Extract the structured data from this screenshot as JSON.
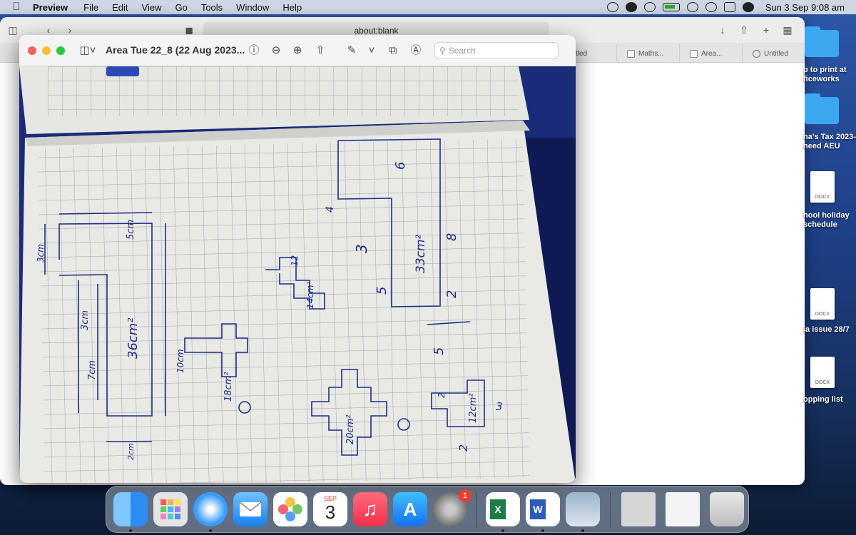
{
  "menubar": {
    "apple": "",
    "app_name": "Preview",
    "menus": [
      "File",
      "Edit",
      "View",
      "Go",
      "Tools",
      "Window",
      "Help"
    ],
    "clock": "Sun 3 Sep  9:08 am"
  },
  "safari": {
    "url": "about:blank",
    "tabs": [
      "tled",
      "Maths...",
      "Area...",
      "Untitled"
    ]
  },
  "preview": {
    "title": "Area Tue 22_8 (22 Aug 2023...",
    "search_placeholder": "Search"
  },
  "desktop": {
    "items": [
      {
        "label": "p to print at\nficeworks",
        "kind": "folder"
      },
      {
        "label": "na's Tax 2023-\nneed AEU",
        "kind": "folder"
      },
      {
        "label": "hool holiday\nschedule",
        "kind": "docx",
        "badge": "DOCX"
      },
      {
        "label": "ia issue 28/7",
        "kind": "docx",
        "badge": "DOCX"
      },
      {
        "label": "opping list",
        "kind": "docx",
        "badge": "DOCX"
      }
    ]
  },
  "notebook": {
    "labels": {
      "l_5cm": "5cm",
      "l_3cm_left": "3cm",
      "l_3cm": "3cm",
      "l_7cm": "7cm",
      "l_36cm2": "36cm²",
      "l_2cm": "2cm",
      "l_10cm": "10cm",
      "l_18cm2": "18cm²",
      "l_14cm2": "14cm²",
      "l_12": "12",
      "l_4": "4",
      "l_3": "3",
      "l_5": "5",
      "l_6": "6",
      "l_33cm2": "33cm²",
      "l_8": "8",
      "l_2": "2",
      "l_5b": "5",
      "l_20cm2": "20cm²",
      "l_12cm2": "12cm²",
      "l_2b": "2",
      "l_2c": "2",
      "l_3b": "3"
    }
  },
  "dock": {
    "calendar_month": "SEP",
    "calendar_day": "3",
    "settings_badge": "1",
    "apps": [
      "finder",
      "launchpad",
      "safari",
      "mail",
      "photos",
      "calendar",
      "music",
      "app-store",
      "system-settings",
      "excel",
      "word",
      "preview",
      "recent-doc-1",
      "recent-doc-2",
      "trash"
    ]
  },
  "colors": {
    "ink": "#1e2f85",
    "traffic_red": "#ff5f57",
    "traffic_yellow": "#febc2e",
    "traffic_green": "#28c840"
  }
}
